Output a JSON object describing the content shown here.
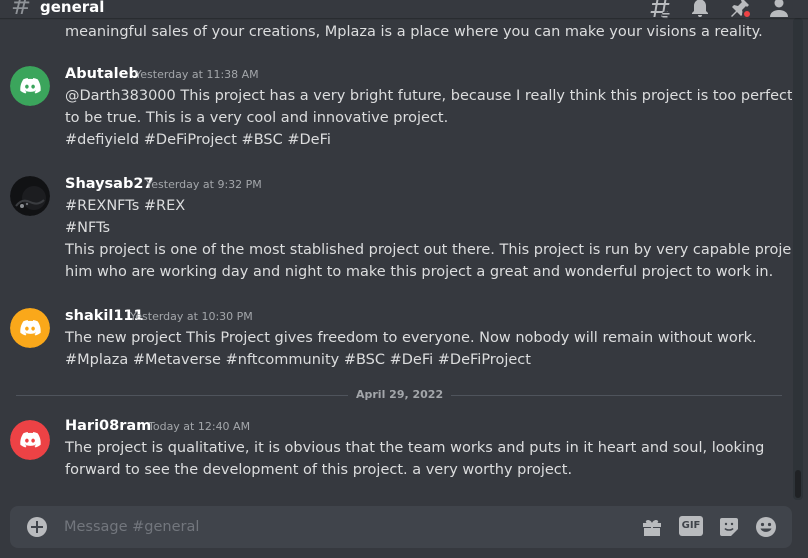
{
  "header": {
    "channel_name": "general",
    "icons": [
      "threads-icon",
      "bell-icon",
      "pin-icon",
      "members-icon"
    ]
  },
  "messages": {
    "cutoff_line": "meaningful sales of your creations, Mplaza is a place where you can make your visions a reality.",
    "items": [
      {
        "author": "Abutaleb",
        "timestamp": "Yesterday at 11:38 AM",
        "avatar_color": "#3ba55c",
        "lines": [
          "@Darth383000 This project has a very bright future, because I really think this project is too perfect",
          "to be true. This is a very cool and innovative project.",
          "#defiyield #DeFiProject #BSC #DeFi"
        ]
      },
      {
        "author": "Shaysab27",
        "timestamp": "Yesterday at 9:32 PM",
        "avatar_color": "#111214",
        "lines": [
          "#REXNFTs #REX",
          "#NFTs",
          "This project is one of the most stablished project out there. This project is run by very capable project",
          "him who are working day and night to make this project a great and wonderful project to work in."
        ]
      },
      {
        "author": "shakil111",
        "timestamp": "Yesterday at 10:30 PM",
        "avatar_color": "#faa81a",
        "lines": [
          "The new project This Project gives freedom to everyone. Now nobody will remain without work.",
          "#Mplaza #Metaverse #nftcommunity #BSC #DeFi #DeFiProject"
        ]
      },
      {
        "author": "Hari08ram",
        "timestamp": "Today at 12:40 AM",
        "avatar_color": "#ed4245",
        "lines": [
          "The project is qualitative, it is obvious that the team works and puts in it heart and soul, looking",
          "forward to see the development of this project. a very worthy project."
        ]
      }
    ],
    "date_divider": "April 29, 2022"
  },
  "composer": {
    "placeholder": "Message #general",
    "gif_label": "GIF",
    "icons": [
      "add-icon",
      "gift-icon",
      "gif-icon",
      "sticker-icon",
      "emoji-icon"
    ]
  }
}
